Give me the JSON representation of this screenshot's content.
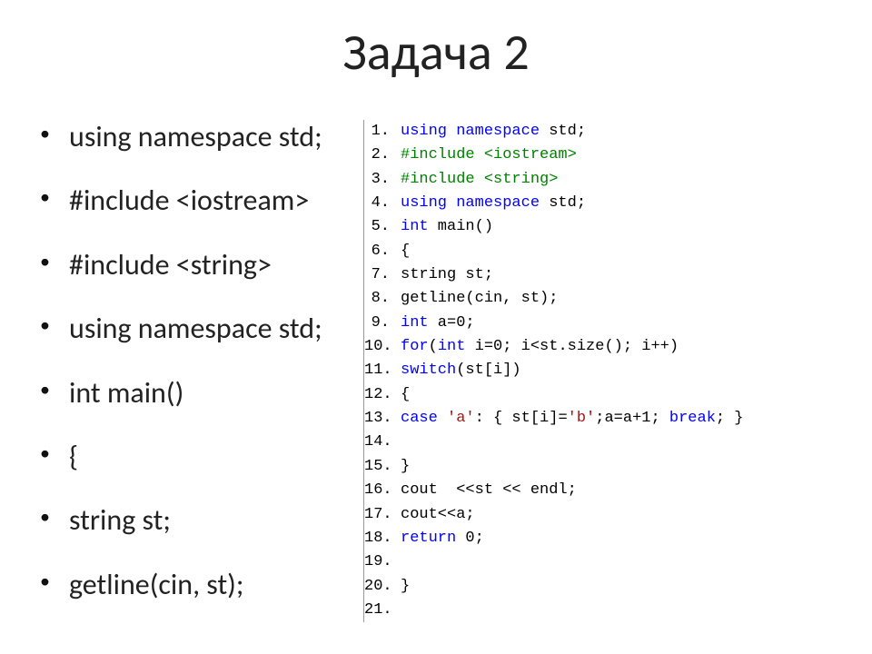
{
  "title": "Задача 2",
  "bullets": [
    "using namespace std;",
    "#include <iostream>",
    "#include <string>",
    "using namespace std;",
    "int main()",
    "{",
    "string st;",
    "getline(cin, st);"
  ],
  "code": [
    {
      "n": 1,
      "segs": [
        {
          "c": "kw",
          "t": "using namespace"
        },
        {
          "c": "txt",
          "t": " std;"
        }
      ]
    },
    {
      "n": 2,
      "segs": [
        {
          "c": "pp",
          "t": "#include <iostream>"
        }
      ]
    },
    {
      "n": 3,
      "segs": [
        {
          "c": "pp",
          "t": "#include <string>"
        }
      ]
    },
    {
      "n": 4,
      "segs": [
        {
          "c": "kw",
          "t": "using namespace"
        },
        {
          "c": "txt",
          "t": " std;"
        }
      ]
    },
    {
      "n": 5,
      "segs": [
        {
          "c": "kw",
          "t": "int"
        },
        {
          "c": "txt",
          "t": " main()"
        }
      ]
    },
    {
      "n": 6,
      "segs": [
        {
          "c": "txt",
          "t": "{"
        }
      ]
    },
    {
      "n": 7,
      "segs": [
        {
          "c": "txt",
          "t": "string st;"
        }
      ]
    },
    {
      "n": 8,
      "segs": [
        {
          "c": "txt",
          "t": "getline(cin, st);"
        }
      ]
    },
    {
      "n": 9,
      "segs": [
        {
          "c": "kw",
          "t": "int"
        },
        {
          "c": "txt",
          "t": " a=0;"
        }
      ]
    },
    {
      "n": 10,
      "segs": [
        {
          "c": "kw",
          "t": "for"
        },
        {
          "c": "txt",
          "t": "("
        },
        {
          "c": "kw",
          "t": "int"
        },
        {
          "c": "txt",
          "t": " i=0; i<st.size(); i++)"
        }
      ]
    },
    {
      "n": 11,
      "segs": [
        {
          "c": "kw",
          "t": "switch"
        },
        {
          "c": "txt",
          "t": "(st[i])"
        }
      ]
    },
    {
      "n": 12,
      "segs": [
        {
          "c": "txt",
          "t": "{"
        }
      ]
    },
    {
      "n": 13,
      "segs": [
        {
          "c": "kw",
          "t": "case"
        },
        {
          "c": "txt",
          "t": " "
        },
        {
          "c": "str",
          "t": "'a'"
        },
        {
          "c": "txt",
          "t": ": { st[i]="
        },
        {
          "c": "str",
          "t": "'b'"
        },
        {
          "c": "txt",
          "t": ";a=a+1; "
        },
        {
          "c": "kw",
          "t": "break"
        },
        {
          "c": "txt",
          "t": "; }"
        }
      ]
    },
    {
      "n": 14,
      "segs": []
    },
    {
      "n": 15,
      "segs": [
        {
          "c": "txt",
          "t": "}"
        }
      ]
    },
    {
      "n": 16,
      "segs": [
        {
          "c": "txt",
          "t": "cout  <<st << endl;"
        }
      ]
    },
    {
      "n": 17,
      "segs": [
        {
          "c": "txt",
          "t": "cout<<a;"
        }
      ]
    },
    {
      "n": 18,
      "segs": [
        {
          "c": "kw",
          "t": "return"
        },
        {
          "c": "txt",
          "t": " 0;"
        }
      ]
    },
    {
      "n": 19,
      "segs": []
    },
    {
      "n": 20,
      "segs": [
        {
          "c": "txt",
          "t": "}"
        }
      ]
    },
    {
      "n": 21,
      "segs": []
    }
  ]
}
